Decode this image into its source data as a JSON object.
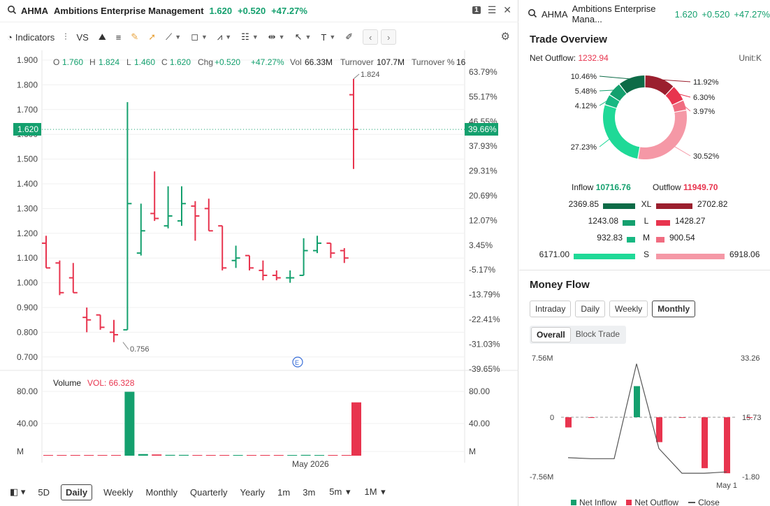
{
  "header": {
    "ticker": "AHMA",
    "name": "Ambitions Enterprise Management",
    "price": "1.620",
    "change": "+0.520",
    "change_pct": "+47.27%",
    "layout_badge": "1"
  },
  "toolbar": {
    "indicators": "Indicators",
    "vs": "VS",
    "text_tool": "T"
  },
  "ohlc": {
    "o_label": "O",
    "o": "1.760",
    "h_label": "H",
    "h": "1.824",
    "l_label": "L",
    "l": "1.460",
    "c_label": "C",
    "c": "1.620",
    "chg_label": "Chg",
    "chg": "+0.520",
    "chg_pct": "+47.27%",
    "vol_label": "Vol",
    "vol": "66.33M",
    "turnover_label": "Turnover",
    "turnover": "107.7M",
    "turnover_pct_label": "Turnover %",
    "turnover_pct": "16"
  },
  "price_axis": [
    "1.900",
    "1.800",
    "1.700",
    "1.600",
    "1.500",
    "1.400",
    "1.300",
    "1.200",
    "1.100",
    "1.000",
    "0.900",
    "0.800",
    "0.700"
  ],
  "pct_axis": [
    "63.79%",
    "55.17%",
    "46.55%",
    "37.93%",
    "29.31%",
    "20.69%",
    "12.07%",
    "3.45%",
    "-5.17%",
    "-13.79%",
    "-22.41%",
    "-31.03%",
    "-39.65%"
  ],
  "current_price_tag": "1.620",
  "current_pct_tag": "39.66%",
  "volume": {
    "label": "Volume",
    "vol_text": "VOL: 66.328",
    "axis": [
      "80.00",
      "40.00",
      "M"
    ]
  },
  "x_axis_label": "May 2026",
  "event_marker": "E",
  "chart_data": {
    "type": "ohlc",
    "high_label": "1.824",
    "low_label": "0.756",
    "ylim": [
      0.68,
      1.92
    ],
    "bars": [
      {
        "o": 1.16,
        "h": 1.19,
        "l": 1.06,
        "c": 1.06
      },
      {
        "o": 1.08,
        "h": 1.09,
        "l": 0.95,
        "c": 0.96
      },
      {
        "o": 1.02,
        "h": 1.08,
        "l": 0.96,
        "c": 0.96
      },
      {
        "o": 0.86,
        "h": 0.9,
        "l": 0.8,
        "c": 0.85
      },
      {
        "o": 0.87,
        "h": 0.87,
        "l": 0.81,
        "c": 0.82
      },
      {
        "o": 0.8,
        "h": 0.85,
        "l": 0.76,
        "c": 0.79
      },
      {
        "o": 0.81,
        "h": 1.73,
        "l": 0.81,
        "c": 1.32
      },
      {
        "o": 1.12,
        "h": 1.32,
        "l": 1.11,
        "c": 1.21
      },
      {
        "o": 1.28,
        "h": 1.45,
        "l": 1.25,
        "c": 1.26
      },
      {
        "o": 1.23,
        "h": 1.39,
        "l": 1.22,
        "c": 1.27
      },
      {
        "o": 1.25,
        "h": 1.39,
        "l": 1.23,
        "c": 1.32
      },
      {
        "o": 1.31,
        "h": 1.33,
        "l": 1.17,
        "c": 1.27
      },
      {
        "o": 1.3,
        "h": 1.34,
        "l": 1.21,
        "c": 1.21
      },
      {
        "o": 1.23,
        "h": 1.23,
        "l": 1.05,
        "c": 1.06
      },
      {
        "o": 1.09,
        "h": 1.15,
        "l": 1.06,
        "c": 1.1
      },
      {
        "o": 1.11,
        "h": 1.11,
        "l": 1.05,
        "c": 1.06
      },
      {
        "o": 1.05,
        "h": 1.09,
        "l": 1.01,
        "c": 1.03
      },
      {
        "o": 1.03,
        "h": 1.05,
        "l": 1.01,
        "c": 1.02
      },
      {
        "o": 1.02,
        "h": 1.05,
        "l": 1.0,
        "c": 1.02
      },
      {
        "o": 1.03,
        "h": 1.18,
        "l": 1.03,
        "c": 1.13
      },
      {
        "o": 1.13,
        "h": 1.19,
        "l": 1.12,
        "c": 1.16
      },
      {
        "o": 1.16,
        "h": 1.16,
        "l": 1.1,
        "c": 1.12
      },
      {
        "o": 1.13,
        "h": 1.14,
        "l": 1.08,
        "c": 1.1
      },
      {
        "o": 1.76,
        "h": 1.824,
        "l": 1.46,
        "c": 1.62
      }
    ],
    "volumes": [
      0.8,
      0.8,
      0.8,
      0.8,
      0.8,
      0.8,
      79.5,
      2,
      1.5,
      1.0,
      1.0,
      0.8,
      0.8,
      0.6,
      0.6,
      0.6,
      0.6,
      0.6,
      0.6,
      1.0,
      0.6,
      0.6,
      0.6,
      66.33
    ],
    "volume_ylim": [
      0,
      85
    ]
  },
  "bottom_bar": {
    "periods": [
      "5D",
      "Daily",
      "Weekly",
      "Monthly",
      "Quarterly",
      "Yearly",
      "1m",
      "3m"
    ],
    "selected": "Daily",
    "extra1": "5m",
    "extra2": "1M"
  },
  "right_header": {
    "ticker": "AHMA",
    "name": "Ambitions Enterprise Mana...",
    "price": "1.620",
    "change": "+0.520",
    "change_pct": "+47.27%"
  },
  "trade_overview": {
    "title": "Trade Overview",
    "net_outflow_label": "Net Outflow:",
    "net_outflow_value": "1232.94",
    "unit": "Unit:K",
    "donut": [
      {
        "label": "11.92%",
        "value": 11.92,
        "color": "#9b1f2e"
      },
      {
        "label": "6.30%",
        "value": 6.3,
        "color": "#e8344e"
      },
      {
        "label": "3.97%",
        "value": 3.97,
        "color": "#f06c80"
      },
      {
        "label": "30.52%",
        "value": 30.52,
        "color": "#f598a6"
      },
      {
        "label": "27.23%",
        "value": 27.23,
        "color": "#1fd997"
      },
      {
        "label": "4.12%",
        "value": 4.12,
        "color": "#17b882"
      },
      {
        "label": "5.48%",
        "value": 5.48,
        "color": "#14a06e"
      },
      {
        "label": "10.46%",
        "value": 10.46,
        "color": "#0d6b47"
      }
    ],
    "inflow_label": "Inflow",
    "inflow_value": "10716.76",
    "outflow_label": "Outflow",
    "outflow_value": "11949.70",
    "rows": [
      {
        "label": "XL",
        "in": "2369.85",
        "out": "2702.82",
        "in_color": "#0d6b47",
        "out_color": "#9b1f2e",
        "in_w": 46,
        "out_w": 52
      },
      {
        "label": "L",
        "in": "1243.08",
        "out": "1428.27",
        "in_color": "#14a06e",
        "out_color": "#e8344e",
        "in_w": 18,
        "out_w": 20
      },
      {
        "label": "M",
        "in": "932.83",
        "out": "900.54",
        "in_color": "#17b882",
        "out_color": "#f06c80",
        "in_w": 12,
        "out_w": 12
      },
      {
        "label": "S",
        "in": "6171.00",
        "out": "6918.06",
        "in_color": "#1fd997",
        "out_color": "#f598a6",
        "in_w": 88,
        "out_w": 98
      }
    ]
  },
  "money_flow": {
    "title": "Money Flow",
    "tabs": [
      "Intraday",
      "Daily",
      "Weekly",
      "Monthly"
    ],
    "selected_tab": "Monthly",
    "subtabs": [
      "Overall",
      "Block Trade"
    ],
    "selected_subtab": "Overall",
    "left_axis": [
      "7.56M",
      "0",
      "-7.56M"
    ],
    "right_axis": [
      "33.26",
      "15.73",
      "-1.80"
    ],
    "x_label": "May 1",
    "legend": [
      "Net Inflow",
      "Net Outflow",
      "Close"
    ],
    "chart_data": {
      "type": "bar",
      "bars": [
        -1.8,
        -0.1,
        0,
        5.5,
        -4.4,
        -0.1,
        -9.0,
        -9.9,
        -0.1
      ],
      "close": [
        3.8,
        3.5,
        3.5,
        31.5,
        6.5,
        -0.8,
        -0.8,
        -0.4
      ],
      "ylim_bars": [
        -10.5,
        10.5
      ]
    }
  }
}
